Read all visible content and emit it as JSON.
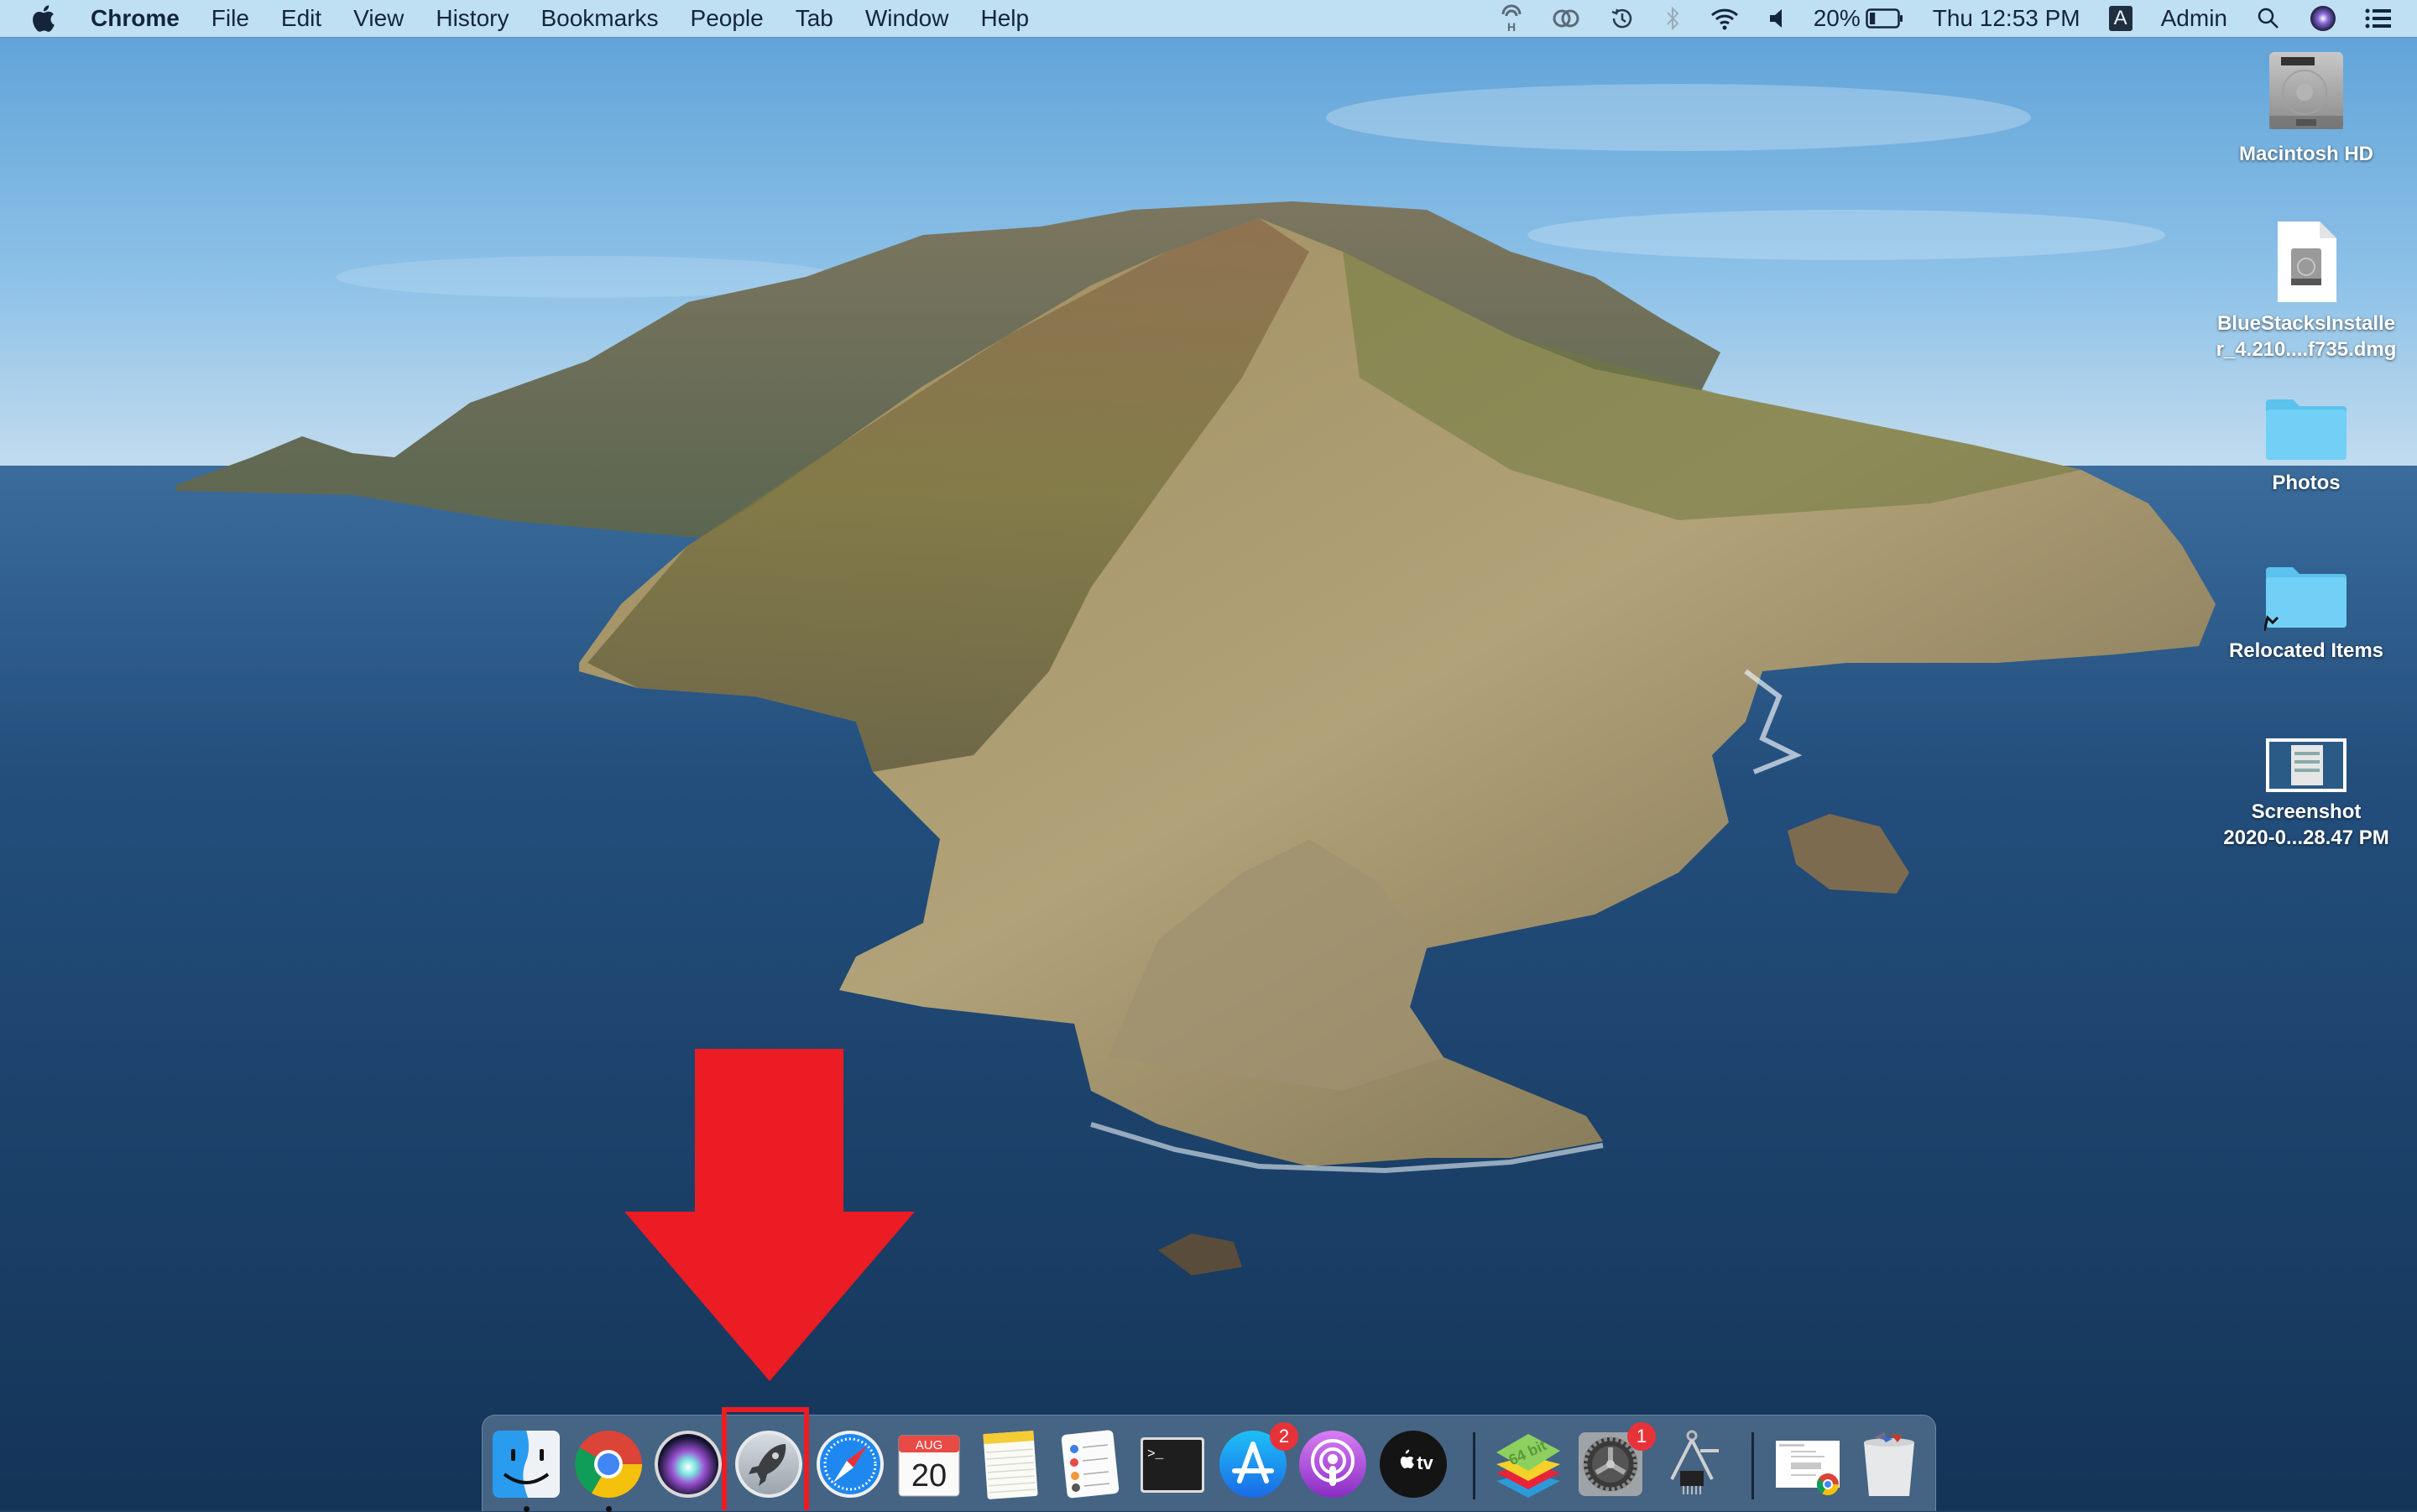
{
  "menubar": {
    "apple_icon": "apple-logo-icon",
    "app_name": "Chrome",
    "menus": [
      "File",
      "Edit",
      "View",
      "History",
      "Bookmarks",
      "People",
      "Tab",
      "Window",
      "Help"
    ],
    "status": {
      "icons": [
        "hotspot-icon",
        "creative-cloud-icon",
        "time-machine-icon",
        "bluetooth-icon",
        "wifi-icon",
        "volume-icon"
      ],
      "battery_percent": "20%",
      "battery_level": 0.2,
      "clock": "Thu 12:53 PM",
      "input_source": "A",
      "user": "Admin",
      "search_icon": "spotlight-icon",
      "siri_icon": "siri-icon",
      "notification_icon": "notification-center-icon"
    }
  },
  "desktop": {
    "icons": [
      {
        "label": "Macintosh HD",
        "kind": "hard-drive"
      },
      {
        "label": "BlueStacksInstaller_4.210....f735.dmg",
        "label_lines": [
          "BlueStacksInstalle",
          "r_4.210....f735.dmg"
        ],
        "kind": "dmg-file"
      },
      {
        "label": "Photos",
        "kind": "folder"
      },
      {
        "label": "Relocated Items",
        "kind": "folder-alias"
      },
      {
        "label": "Screenshot 2020-0...28.47 PM",
        "label_lines": [
          "Screenshot",
          "2020-0...28.47 PM"
        ],
        "kind": "image-file"
      }
    ]
  },
  "dock": {
    "apps": [
      {
        "name": "Finder",
        "running": true
      },
      {
        "name": "Google Chrome",
        "running": true
      },
      {
        "name": "Siri",
        "running": false
      },
      {
        "name": "Launchpad",
        "running": false,
        "highlighted": true
      },
      {
        "name": "Safari",
        "running": false
      },
      {
        "name": "Calendar",
        "running": false,
        "month": "AUG",
        "day": "20"
      },
      {
        "name": "Notes",
        "running": false
      },
      {
        "name": "Reminders",
        "running": false
      },
      {
        "name": "Terminal",
        "running": false,
        "prompt": ">_"
      },
      {
        "name": "App Store",
        "running": false,
        "badge": "2"
      },
      {
        "name": "Podcasts",
        "running": false
      },
      {
        "name": "TV",
        "running": false,
        "label": "tv"
      }
    ],
    "extra_apps": [
      {
        "name": "BlueStacks",
        "label": "64 bit"
      },
      {
        "name": "System Preferences",
        "badge": "1"
      },
      {
        "name": "System Information"
      }
    ],
    "stacks": [
      {
        "name": "Downloads"
      },
      {
        "name": "Trash"
      }
    ]
  },
  "annotation": {
    "type": "arrow-down",
    "target": "Launchpad",
    "color": "#ec1c24"
  }
}
